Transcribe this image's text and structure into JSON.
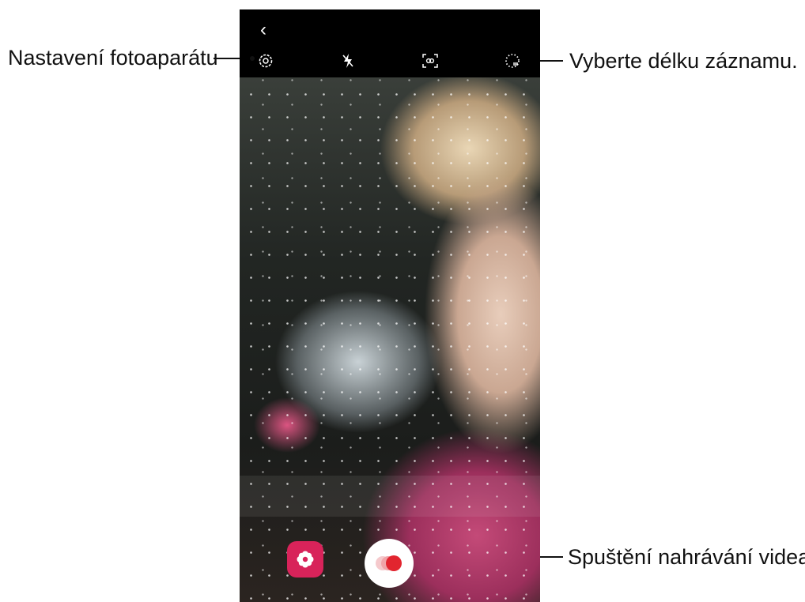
{
  "callouts": {
    "camera_settings": "Nastavení fotoaparátu",
    "record_length": "Vyberte délku záznamu.",
    "start_recording": "Spuštění nahrávání videa."
  },
  "toolbar": {
    "back_glyph": "‹",
    "icons": [
      "back-icon",
      "settings-gear-icon",
      "flash-off-icon",
      "motion-detection-icon",
      "record-length-icon"
    ]
  },
  "buttons": {
    "effect_icon": "flower-icon",
    "record_icon": "record-icon"
  },
  "colors": {
    "accent": "#d8235a",
    "record_red": "#e2252f",
    "record_light": "#f0a3a8"
  }
}
